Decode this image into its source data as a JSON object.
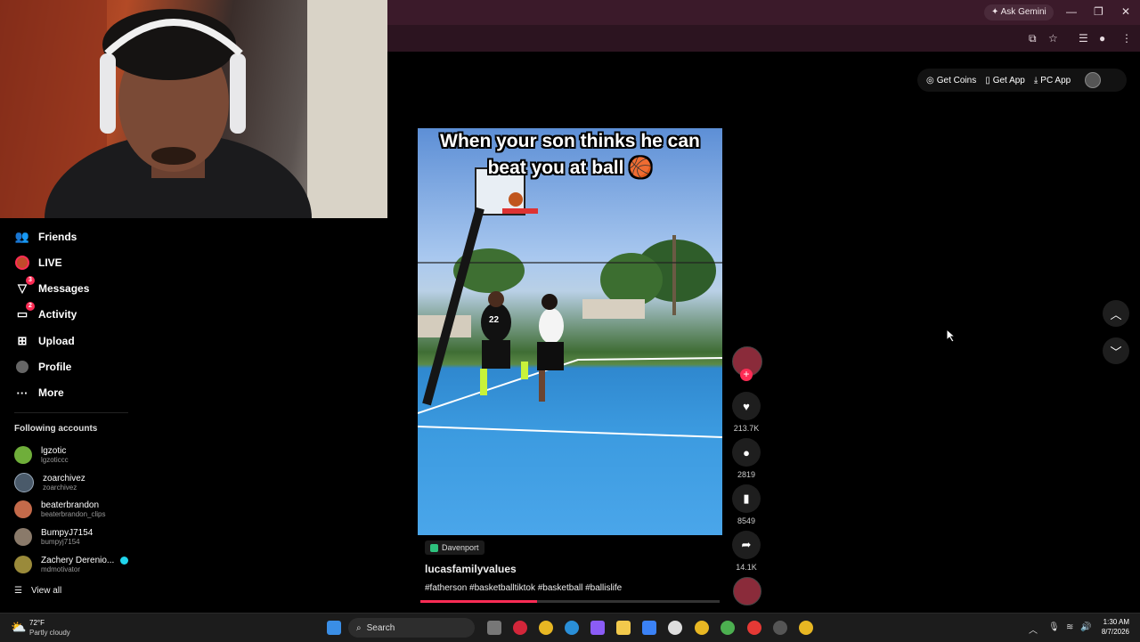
{
  "browser": {
    "gemini_label": "Ask Gemini",
    "icons": [
      "sparkle-icon",
      "minimize-icon",
      "restore-icon",
      "close-icon",
      "cast-icon",
      "star-icon",
      "tab-search-icon",
      "profile-icon",
      "menu-icon"
    ]
  },
  "top_actions": {
    "coins": "Get Coins",
    "app": "Get App",
    "pc_app": "PC App"
  },
  "sidebar": {
    "nav": [
      {
        "label": "Friends",
        "icon": "friends-icon",
        "badge": ""
      },
      {
        "label": "LIVE",
        "icon": "live-icon",
        "badge": ""
      },
      {
        "label": "Messages",
        "icon": "messages-icon",
        "badge": "3"
      },
      {
        "label": "Activity",
        "icon": "activity-icon",
        "badge": "2"
      },
      {
        "label": "Upload",
        "icon": "upload-icon",
        "badge": ""
      },
      {
        "label": "Profile",
        "icon": "profile-icon",
        "badge": ""
      },
      {
        "label": "More",
        "icon": "more-icon",
        "badge": ""
      }
    ],
    "following_title": "Following accounts",
    "accounts": [
      {
        "name": "lgzotic",
        "handle": "lgzoticcc",
        "color": "#6fae3a"
      },
      {
        "name": "zoarchivez",
        "handle": "zoarchivez",
        "color": "#4a5a6a"
      },
      {
        "name": "beaterbrandon",
        "handle": "beaterbrandon_clips",
        "color": "#c46a4a"
      },
      {
        "name": "BumpyJ7154",
        "handle": "bumpyj7154",
        "color": "#8a7a6a"
      },
      {
        "name": "Zachery Derenio...",
        "handle": "mdmotivator",
        "color": "#9a8a3a"
      }
    ],
    "view_all": "View all"
  },
  "video": {
    "caption_line1": "When your son thinks he can",
    "caption_line2": "beat you at ball 🏀",
    "jersey": "22",
    "location": "Davenport",
    "username": "lucasfamilyvalues",
    "hashtags": "#fatherson #basketballtiktok #basketball #ballislife",
    "progress": 0.39
  },
  "actions": {
    "likes": "213.7K",
    "comments": "2819",
    "saves": "8549",
    "shares": "14.1K"
  },
  "taskbar": {
    "temp": "72°F",
    "weather": "Partly cloudy",
    "search": "Search",
    "time": "1:30 AM",
    "date": "8/7/2026"
  }
}
